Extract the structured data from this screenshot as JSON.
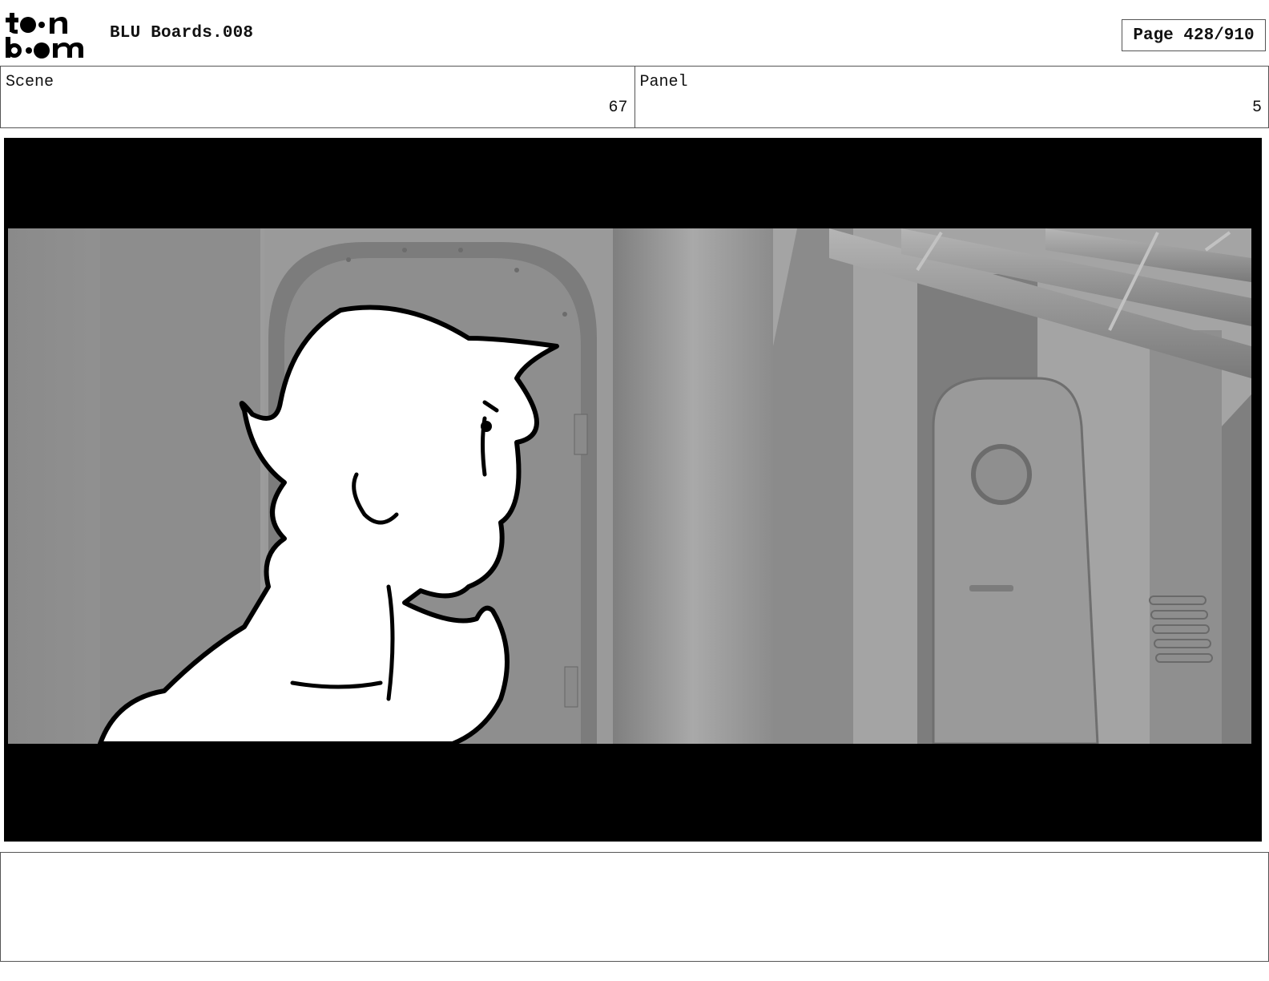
{
  "header": {
    "logo_text": "toon boom",
    "title": "BLU Boards.008",
    "page_label": "Page 428/910"
  },
  "scene": {
    "label": "Scene",
    "value": "67"
  },
  "panel": {
    "label": "Panel",
    "value": "5"
  },
  "frame": {
    "icon": "storyboard-panel-image"
  },
  "notes": {
    "text": ""
  }
}
